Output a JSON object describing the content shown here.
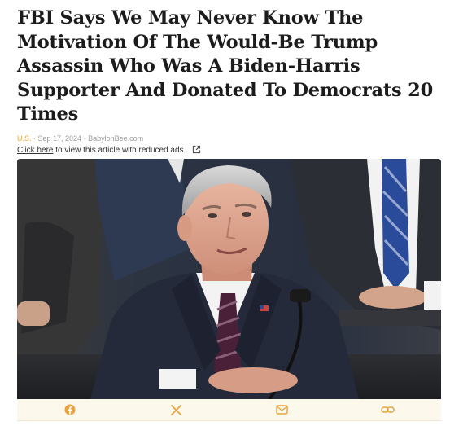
{
  "article": {
    "headline": "FBI Says We May Never Know The Motivation Of The Would-Be Trump Assassin Who Was A Biden-Harris Supporter And Donated To Democrats 20 Times",
    "section": "U.S.",
    "separator1": " · ",
    "date": "Sep 17, 2024",
    "separator2": " · ",
    "source": "BabylonBee.com",
    "reduced_ads_link": "Click here",
    "reduced_ads_text": " to view this article with reduced ads.",
    "image_alt": "Man in suit speaking into microphone at congressional hearing"
  },
  "share": {
    "buttons": [
      {
        "name": "facebook",
        "icon": "facebook-icon"
      },
      {
        "name": "x",
        "icon": "x-icon"
      },
      {
        "name": "email",
        "icon": "mail-icon"
      },
      {
        "name": "copy-link",
        "icon": "link-icon"
      }
    ],
    "accent_color": "#e8a33d"
  },
  "colors": {
    "headline": "#1c1c1c",
    "meta": "#9a9a9a",
    "section": "#e8a33d",
    "share_bar_bg": "#fdf8ec"
  }
}
